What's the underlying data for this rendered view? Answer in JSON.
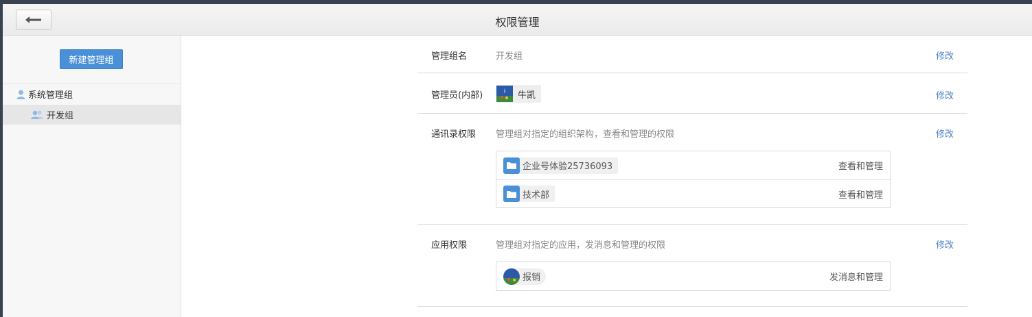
{
  "header": {
    "title": "权限管理",
    "back_icon": "arrow-left-icon"
  },
  "sidebar": {
    "new_group_label": "新建管理组",
    "tree": [
      {
        "label": "系统管理组",
        "icon": "user-icon"
      },
      {
        "label": "开发组",
        "icon": "users-icon",
        "selected": true
      }
    ]
  },
  "group_name": {
    "label": "管理组名",
    "value": "开发组",
    "edit": "修改"
  },
  "admins": {
    "label": "管理员(内部)",
    "members": [
      {
        "name": "牛凯"
      }
    ],
    "edit": "修改"
  },
  "contacts_perm": {
    "label": "通讯录权限",
    "desc": "管理组对指定的组织架构，查看和管理的权限",
    "edit": "修改",
    "items": [
      {
        "name": "企业号体验25736093",
        "perm": "查看和管理",
        "icon": "folder-icon"
      },
      {
        "name": "技术部",
        "perm": "查看和管理",
        "icon": "folder-icon"
      }
    ]
  },
  "app_perm": {
    "label": "应用权限",
    "desc": "管理组对指定的应用，发消息和管理的权限",
    "edit": "修改",
    "items": [
      {
        "name": "报销",
        "perm": "发消息和管理",
        "icon": "app-avatar-icon"
      }
    ]
  },
  "colors": {
    "accent": "#4a90d9",
    "link": "#4a7fc4"
  }
}
